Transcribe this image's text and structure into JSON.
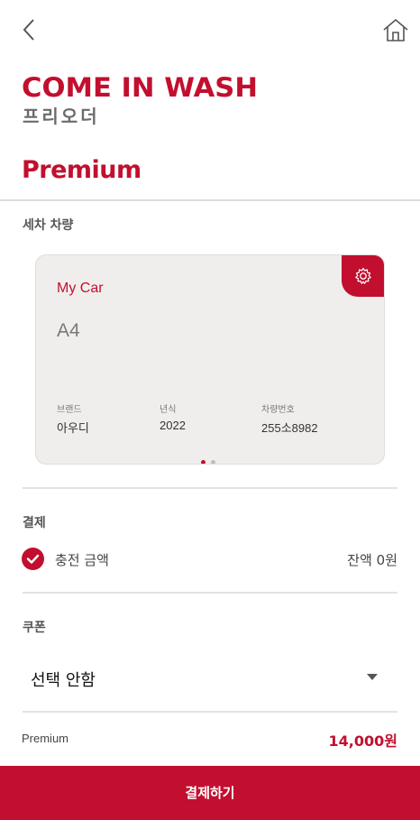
{
  "header": {
    "back_icon": "chevron-left-icon",
    "home_icon": "home-icon"
  },
  "brand": {
    "logo_text": "COME IN WASH",
    "subtitle": "프리오더",
    "color": "#c20f2f"
  },
  "page": {
    "title": "Premium"
  },
  "vehicle_section": {
    "label": "세차 차량",
    "card": {
      "tag": "My Car",
      "model": "A4",
      "settings_icon": "gear-icon",
      "fields": [
        {
          "label": "브랜드",
          "value": "아우디"
        },
        {
          "label": "년식",
          "value": "2022"
        },
        {
          "label": "차량번호",
          "value": "255소8982"
        }
      ],
      "pagination": {
        "count": 2,
        "active": 0
      }
    }
  },
  "payment_section": {
    "label": "결제",
    "option": "충전 금액",
    "option_checked": true,
    "balance": "잔액 0원"
  },
  "coupon_section": {
    "label": "쿠폰",
    "selected": "선택 안함"
  },
  "summary": {
    "name": "Premium",
    "price": "14,000원"
  },
  "pay_button": "결제하기"
}
